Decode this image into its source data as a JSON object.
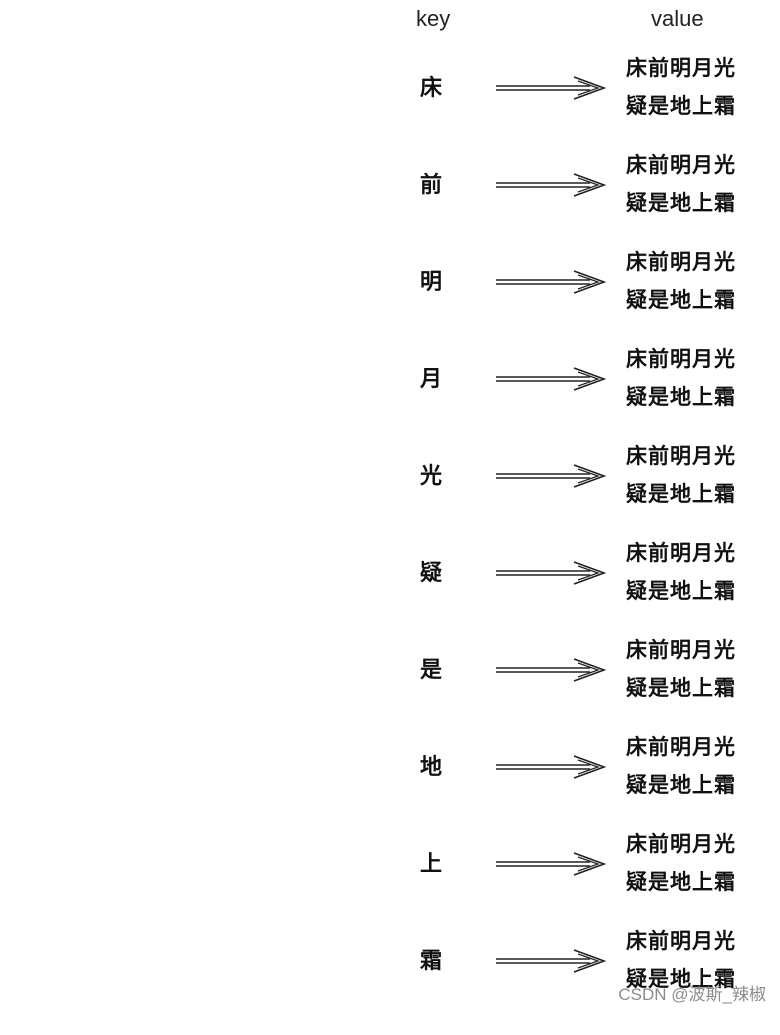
{
  "headers": {
    "key": "key",
    "value": "value"
  },
  "rows": [
    {
      "key": "床",
      "value_line1": "床前明月光",
      "value_line2": "疑是地上霜"
    },
    {
      "key": "前",
      "value_line1": "床前明月光",
      "value_line2": "疑是地上霜"
    },
    {
      "key": "明",
      "value_line1": "床前明月光",
      "value_line2": "疑是地上霜"
    },
    {
      "key": "月",
      "value_line1": "床前明月光",
      "value_line2": "疑是地上霜"
    },
    {
      "key": "光",
      "value_line1": "床前明月光",
      "value_line2": "疑是地上霜"
    },
    {
      "key": "疑",
      "value_line1": "床前明月光",
      "value_line2": "疑是地上霜"
    },
    {
      "key": "是",
      "value_line1": "床前明月光",
      "value_line2": "疑是地上霜"
    },
    {
      "key": "地",
      "value_line1": "床前明月光",
      "value_line2": "疑是地上霜"
    },
    {
      "key": "上",
      "value_line1": "床前明月光",
      "value_line2": "疑是地上霜"
    },
    {
      "key": "霜",
      "value_line1": "床前明月光",
      "value_line2": "疑是地上霜"
    }
  ],
  "arrow_icon": "right-double-line-arrow-icon",
  "watermark": "CSDN @波斯_辣椒"
}
